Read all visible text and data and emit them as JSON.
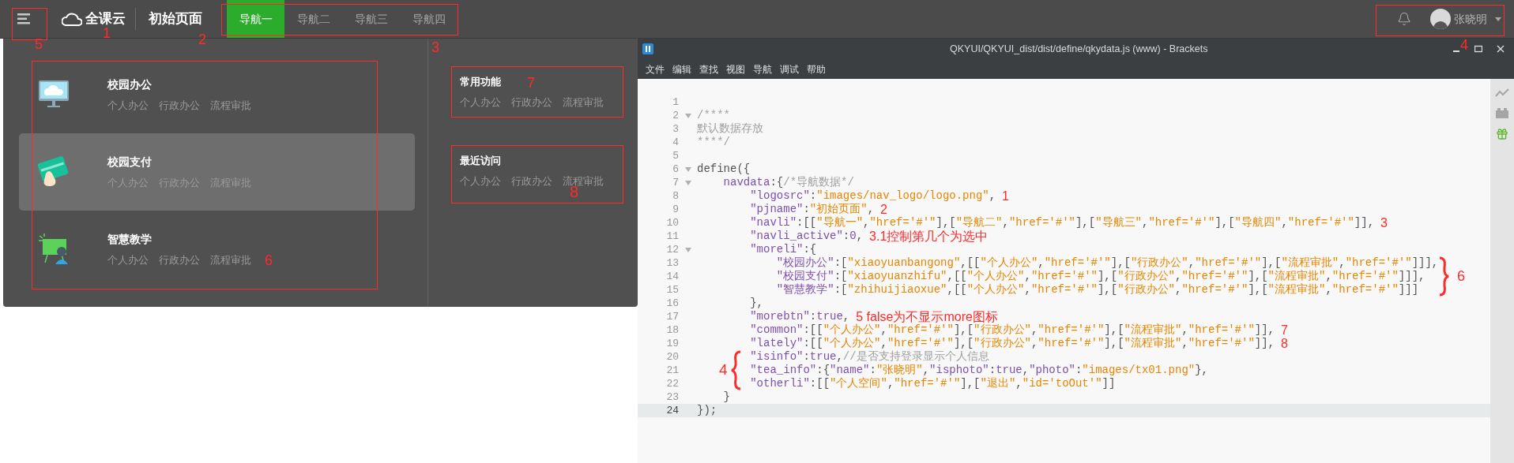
{
  "header": {
    "menu_note": "5",
    "logo": {
      "text": "全课云",
      "note": "1"
    },
    "title": {
      "text": "初始页面",
      "note": "2"
    },
    "nav": {
      "note": "3",
      "items": [
        {
          "label": "导航一",
          "selected": true
        },
        {
          "label": "导航二",
          "selected": false
        },
        {
          "label": "导航三",
          "selected": false
        },
        {
          "label": "导航四",
          "selected": false
        }
      ]
    },
    "user": {
      "name": "张晓明",
      "note": "4"
    }
  },
  "mega_menu": {
    "note": "6",
    "categories": [
      {
        "kind": "oa",
        "title": "校园办公",
        "highlighted": false,
        "links": [
          "个人办公",
          "行政办公",
          "流程审批"
        ]
      },
      {
        "kind": "card",
        "title": "校园支付",
        "highlighted": true,
        "links": [
          "个人办公",
          "行政办公",
          "流程审批"
        ]
      },
      {
        "kind": "teaching",
        "title": "智慧教学",
        "highlighted": false,
        "links": [
          "个人办公",
          "行政办公",
          "流程审批"
        ]
      }
    ],
    "groups": [
      {
        "title": "常用功能",
        "note": "7",
        "links": [
          "个人办公",
          "行政办公",
          "流程审批"
        ]
      },
      {
        "title": "最近访问",
        "note": "8",
        "links": [
          "个人办公",
          "行政办公",
          "流程审批"
        ]
      }
    ]
  },
  "editor": {
    "title": "QKYUI/QKYUI_dist/dist/define/qkydata.js (www) - Brackets",
    "menu": [
      "文件",
      "编辑",
      "查找",
      "视图",
      "导航",
      "调试",
      "帮助"
    ],
    "lines": [
      {
        "number": "1",
        "fold": false,
        "active": false
      },
      {
        "number": "2",
        "fold": true,
        "active": false,
        "code": "/****"
      },
      {
        "number": "3",
        "fold": false,
        "active": false,
        "code": "默认数据存放"
      },
      {
        "number": "4",
        "fold": false,
        "active": false,
        "code": "****/"
      },
      {
        "number": "5",
        "fold": false,
        "active": false
      },
      {
        "number": "6",
        "fold": true,
        "active": false,
        "code": "define({"
      },
      {
        "number": "7",
        "fold": true,
        "active": false,
        "code": "    navdata:{/*导航数据*/"
      },
      {
        "number": "8",
        "fold": false,
        "active": false,
        "code": "        \"logosrc\":\"images/nav_logo/logo.png\",",
        "note": "1"
      },
      {
        "number": "9",
        "fold": false,
        "active": false,
        "code": "        \"pjname\":\"初始页面\",",
        "note": "2"
      },
      {
        "number": "10",
        "fold": false,
        "active": false,
        "code": "        \"navli\":[[\"导航一\",\"href='#'\"],[\"导航二\",\"href='#'\"],[\"导航三\",\"href='#'\"],[\"导航四\",\"href='#'\"]],",
        "note": "3"
      },
      {
        "number": "11",
        "fold": false,
        "active": false,
        "code": "        \"navli_active\":0,",
        "note": "3.1控制第几个为选中"
      },
      {
        "number": "12",
        "fold": true,
        "active": false,
        "code": "        \"moreli\":{"
      },
      {
        "number": "13",
        "fold": false,
        "active": false,
        "code": "            \"校园办公\":[\"xiaoyuanbangong\",[[\"个人办公\",\"href='#'\"],[\"行政办公\",\"href='#'\"],[\"流程审批\",\"href='#'\"]]],"
      },
      {
        "number": "14",
        "fold": false,
        "active": false,
        "brace": {
          "kind": "right",
          "note": "6"
        },
        "code": "            \"校园支付\":[\"xiaoyuanzhifu\",[[\"个人办公\",\"href='#'\"],[\"行政办公\",\"href='#'\"],[\"流程审批\",\"href='#'\"]]],"
      },
      {
        "number": "15",
        "fold": false,
        "active": false,
        "code": "            \"智慧教学\":[\"zhihuijiaoxue\",[[\"个人办公\",\"href='#'\"],[\"行政办公\",\"href='#'\"],[\"流程审批\",\"href='#'\"]]]"
      },
      {
        "number": "16",
        "fold": false,
        "active": false,
        "code": "        },"
      },
      {
        "number": "17",
        "fold": false,
        "active": false,
        "code": "        \"morebtn\":true,",
        "note": "5 false为不显示more图标"
      },
      {
        "number": "18",
        "fold": false,
        "active": false,
        "code": "        \"common\":[[\"个人办公\",\"href='#'\"],[\"行政办公\",\"href='#'\"],[\"流程审批\",\"href='#'\"]],",
        "note": "7"
      },
      {
        "number": "19",
        "fold": false,
        "active": false,
        "code": "        \"lately\":[[\"个人办公\",\"href='#'\"],[\"行政办公\",\"href='#'\"],[\"流程审批\",\"href='#'\"]],",
        "note": "8"
      },
      {
        "number": "20",
        "fold": false,
        "active": false,
        "code": "        \"isinfo\":true,//是否支持登录显示个人信息"
      },
      {
        "number": "21",
        "fold": false,
        "active": false,
        "brace": {
          "kind": "left",
          "note": "4"
        },
        "code": "        \"tea_info\":{\"name\":\"张晓明\",\"isphoto\":true,\"photo\":\"images/tx01.png\"},"
      },
      {
        "number": "22",
        "fold": false,
        "active": false,
        "code": "        \"otherli\":[[\"个人空间\",\"href='#'\"],[\"退出\",\"id='toOut'\"]]"
      },
      {
        "number": "23",
        "fold": false,
        "active": false,
        "code": "    }"
      },
      {
        "number": "24",
        "fold": false,
        "active": true,
        "code": "});"
      }
    ]
  }
}
